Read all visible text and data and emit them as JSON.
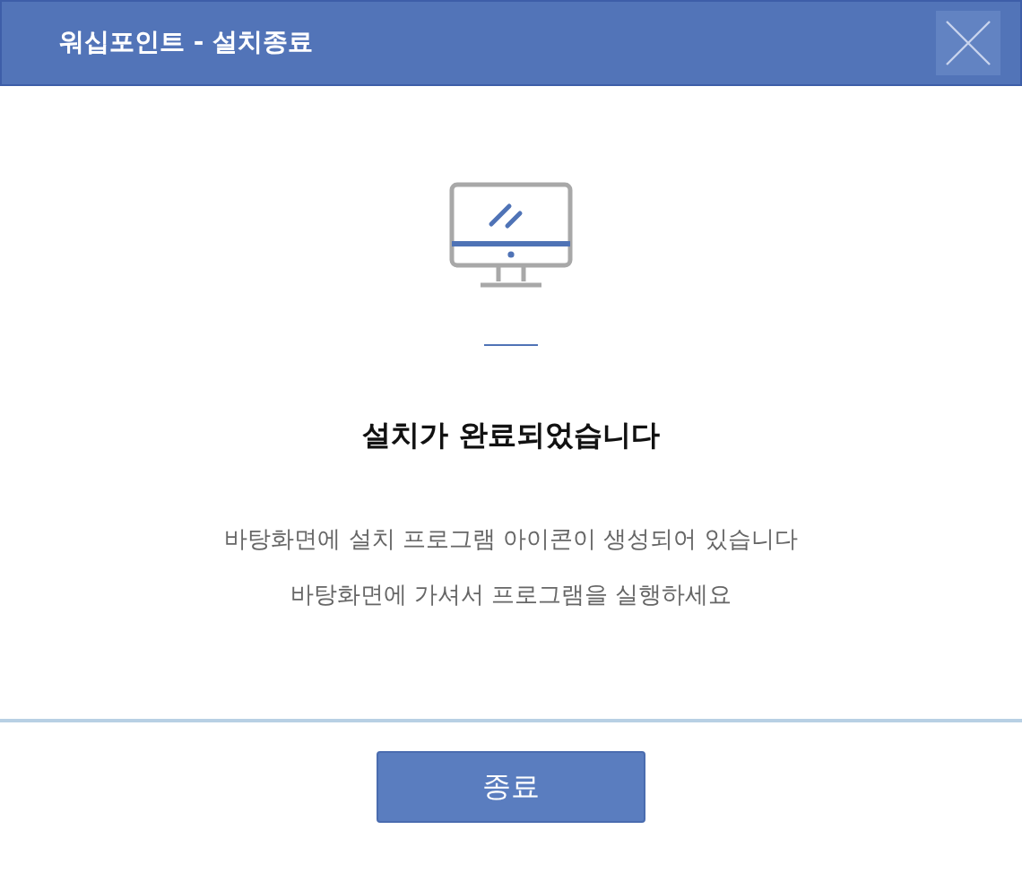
{
  "window": {
    "title": "워십포인트 - 설치종료"
  },
  "heading": "설치가 완료되었습니다",
  "messages": [
    "바탕화면에 설치 프로그램 아이콘이 생성되어 있습니다",
    "바탕화면에 가셔서 프로그램을 실행하세요"
  ],
  "buttons": [
    "종료"
  ]
}
